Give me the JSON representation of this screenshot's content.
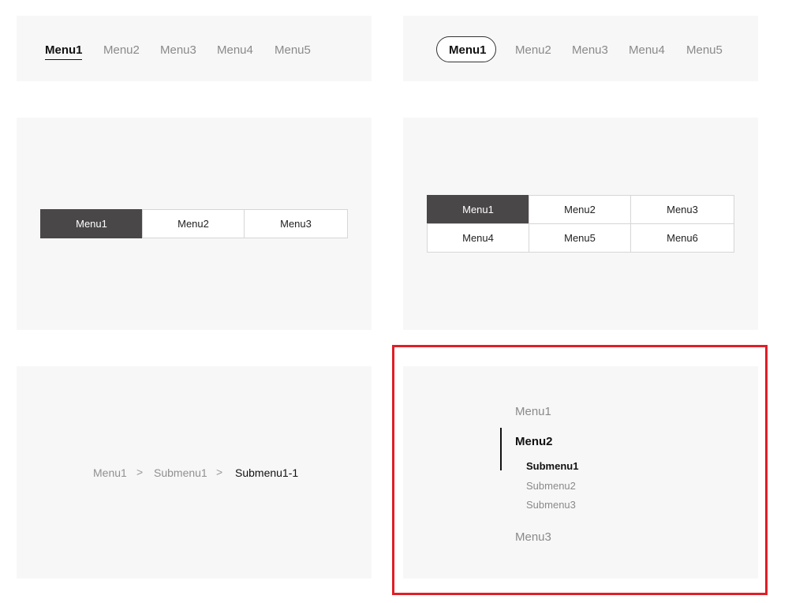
{
  "underline_tabs": {
    "items": [
      "Menu1",
      "Menu2",
      "Menu3",
      "Menu4",
      "Menu5"
    ],
    "active": 0
  },
  "pill_tabs": {
    "items": [
      "Menu1",
      "Menu2",
      "Menu3",
      "Menu4",
      "Menu5"
    ],
    "active": 0
  },
  "segment_single": {
    "items": [
      "Menu1",
      "Menu2",
      "Menu3"
    ],
    "active": 0
  },
  "segment_grid": {
    "rows": [
      [
        "Menu1",
        "Menu2",
        "Menu3"
      ],
      [
        "Menu4",
        "Menu5",
        "Menu6"
      ]
    ],
    "active": "Menu1"
  },
  "breadcrumb": {
    "items": [
      "Menu1",
      "Submenu1",
      "Submenu1-1"
    ],
    "separator": ">"
  },
  "side_menu": {
    "items": [
      {
        "label": "Menu1"
      },
      {
        "label": "Menu2",
        "active": true,
        "children": [
          "Submenu1",
          "Submenu2",
          "Submenu3"
        ]
      },
      {
        "label": "Menu3"
      }
    ],
    "active_child": "Submenu1"
  },
  "colors": {
    "active_fill": "#4a4749",
    "panel_bg": "#f7f7f7",
    "highlight": "#e01e27"
  }
}
